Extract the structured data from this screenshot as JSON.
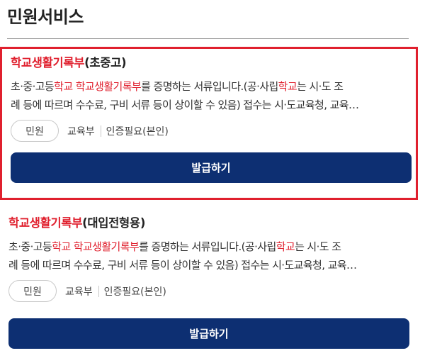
{
  "page": {
    "title": "민원서비스"
  },
  "colors": {
    "highlight": "#e0202e",
    "button_bg": "#0d2f72",
    "selected_border": "#e0202e"
  },
  "cards": [
    {
      "title_highlight": "학교생활기록부",
      "title_rest": "(초중고)",
      "desc_line1_a": "초·중·고등",
      "desc_line1_hl1": "학교",
      "desc_line1_b": " ",
      "desc_line1_hl2": "학교생활기록부",
      "desc_line1_c": "를 증명하는 서류입니다.(공·사립",
      "desc_line1_hl3": "학교",
      "desc_line1_d": "는 시·도 조",
      "desc_line2": "례 등에 따르며 수수료, 구비 서류 등이 상이할 수 있음) 접수는 시·도교육청, 교육…",
      "chip": "민원",
      "agency": "교육부",
      "auth": "인증필요(본인)",
      "button": "발급하기"
    },
    {
      "title_highlight": "학교생활기록부",
      "title_rest": "(대입전형용)",
      "desc_line1_a": "초·중·고등",
      "desc_line1_hl1": "학교",
      "desc_line1_b": " ",
      "desc_line1_hl2": "학교생활기록부",
      "desc_line1_c": "를 증명하는 서류입니다.(공·사립",
      "desc_line1_hl3": "학교",
      "desc_line1_d": "는 시·도 조",
      "desc_line2": "례 등에 따르며 수수료, 구비 서류 등이 상이할 수 있음) 접수는 시·도교육청, 교육…",
      "chip": "민원",
      "agency": "교육부",
      "auth": "인증필요(본인)",
      "button": "발급하기"
    }
  ]
}
